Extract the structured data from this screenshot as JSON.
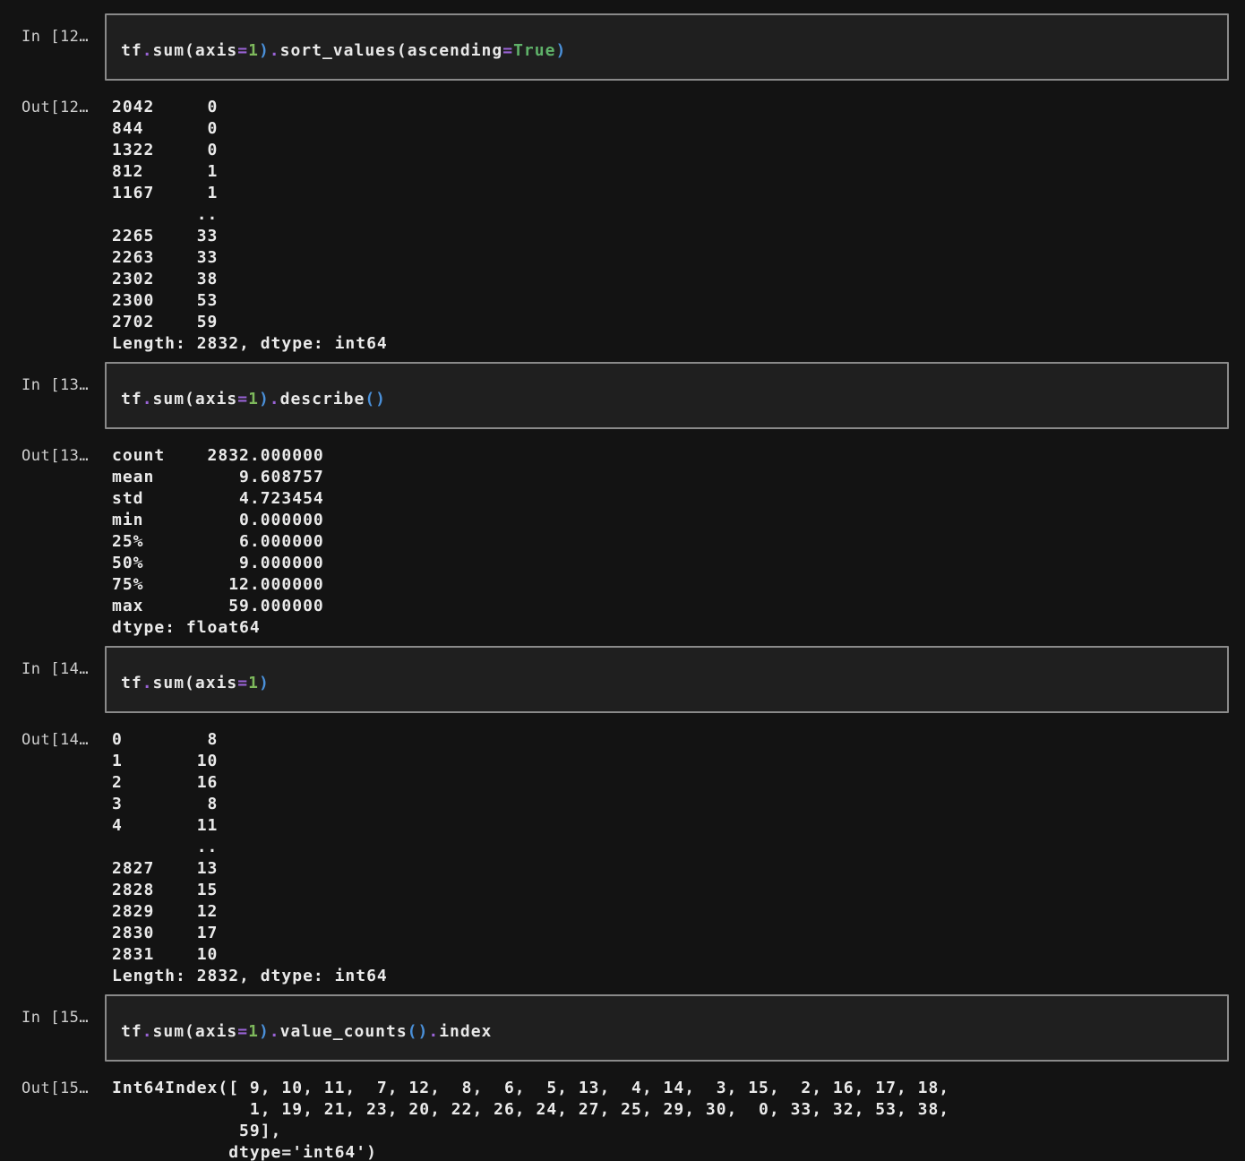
{
  "page": {
    "background": "#131313",
    "cell_background": "#1f1f1f",
    "cell_border": "#8a8a8a"
  },
  "colors": {
    "plain": "#e8e8e8",
    "operator": "#9a63d6",
    "number": "#7eb95c",
    "keyword": "#5fb269",
    "bracket": "#4a90d9"
  },
  "cells": [
    {
      "kind": "input",
      "prompt": "In [12…",
      "tokens": [
        {
          "text": "tf",
          "color": "plain"
        },
        {
          "text": ".",
          "color": "operator"
        },
        {
          "text": "sum",
          "color": "plain"
        },
        {
          "text": "(",
          "color": "plain"
        },
        {
          "text": "axis",
          "color": "plain"
        },
        {
          "text": "=",
          "color": "operator"
        },
        {
          "text": "1",
          "color": "number"
        },
        {
          "text": ")",
          "color": "bracket"
        },
        {
          "text": ".",
          "color": "operator"
        },
        {
          "text": "sort_values",
          "color": "plain"
        },
        {
          "text": "(",
          "color": "plain"
        },
        {
          "text": "ascending",
          "color": "plain"
        },
        {
          "text": "=",
          "color": "operator"
        },
        {
          "text": "True",
          "color": "keyword"
        },
        {
          "text": ")",
          "color": "bracket"
        }
      ]
    },
    {
      "kind": "output",
      "prompt": "Out[12…",
      "lines": [
        "2042     0",
        "844      0",
        "1322     0",
        "812      1",
        "1167     1",
        "        ..",
        "2265    33",
        "2263    33",
        "2302    38",
        "2300    53",
        "2702    59",
        "Length: 2832, dtype: int64"
      ]
    },
    {
      "kind": "input",
      "prompt": "In [13…",
      "tokens": [
        {
          "text": "tf",
          "color": "plain"
        },
        {
          "text": ".",
          "color": "operator"
        },
        {
          "text": "sum",
          "color": "plain"
        },
        {
          "text": "(",
          "color": "plain"
        },
        {
          "text": "axis",
          "color": "plain"
        },
        {
          "text": "=",
          "color": "operator"
        },
        {
          "text": "1",
          "color": "number"
        },
        {
          "text": ")",
          "color": "bracket"
        },
        {
          "text": ".",
          "color": "operator"
        },
        {
          "text": "describe",
          "color": "plain"
        },
        {
          "text": "()",
          "color": "bracket"
        }
      ]
    },
    {
      "kind": "output",
      "prompt": "Out[13…",
      "lines": [
        "count    2832.000000",
        "mean        9.608757",
        "std         4.723454",
        "min         0.000000",
        "25%         6.000000",
        "50%         9.000000",
        "75%        12.000000",
        "max        59.000000",
        "dtype: float64"
      ]
    },
    {
      "kind": "input",
      "prompt": "In [14…",
      "tokens": [
        {
          "text": "tf",
          "color": "plain"
        },
        {
          "text": ".",
          "color": "operator"
        },
        {
          "text": "sum",
          "color": "plain"
        },
        {
          "text": "(",
          "color": "plain"
        },
        {
          "text": "axis",
          "color": "plain"
        },
        {
          "text": "=",
          "color": "operator"
        },
        {
          "text": "1",
          "color": "number"
        },
        {
          "text": ")",
          "color": "bracket"
        }
      ]
    },
    {
      "kind": "output",
      "prompt": "Out[14…",
      "lines": [
        "0        8",
        "1       10",
        "2       16",
        "3        8",
        "4       11",
        "        ..",
        "2827    13",
        "2828    15",
        "2829    12",
        "2830    17",
        "2831    10",
        "Length: 2832, dtype: int64"
      ]
    },
    {
      "kind": "input",
      "prompt": "In [15…",
      "tokens": [
        {
          "text": "tf",
          "color": "plain"
        },
        {
          "text": ".",
          "color": "operator"
        },
        {
          "text": "sum",
          "color": "plain"
        },
        {
          "text": "(",
          "color": "plain"
        },
        {
          "text": "axis",
          "color": "plain"
        },
        {
          "text": "=",
          "color": "operator"
        },
        {
          "text": "1",
          "color": "number"
        },
        {
          "text": ")",
          "color": "bracket"
        },
        {
          "text": ".",
          "color": "operator"
        },
        {
          "text": "value_counts",
          "color": "plain"
        },
        {
          "text": "()",
          "color": "bracket"
        },
        {
          "text": ".",
          "color": "operator"
        },
        {
          "text": "index",
          "color": "plain"
        }
      ]
    },
    {
      "kind": "output",
      "prompt": "Out[15…",
      "lines": [
        "Int64Index([ 9, 10, 11,  7, 12,  8,  6,  5, 13,  4, 14,  3, 15,  2, 16, 17, 18,",
        "             1, 19, 21, 23, 20, 22, 26, 24, 27, 25, 29, 30,  0, 33, 32, 53, 38,",
        "            59],",
        "           dtype='int64')"
      ]
    }
  ]
}
